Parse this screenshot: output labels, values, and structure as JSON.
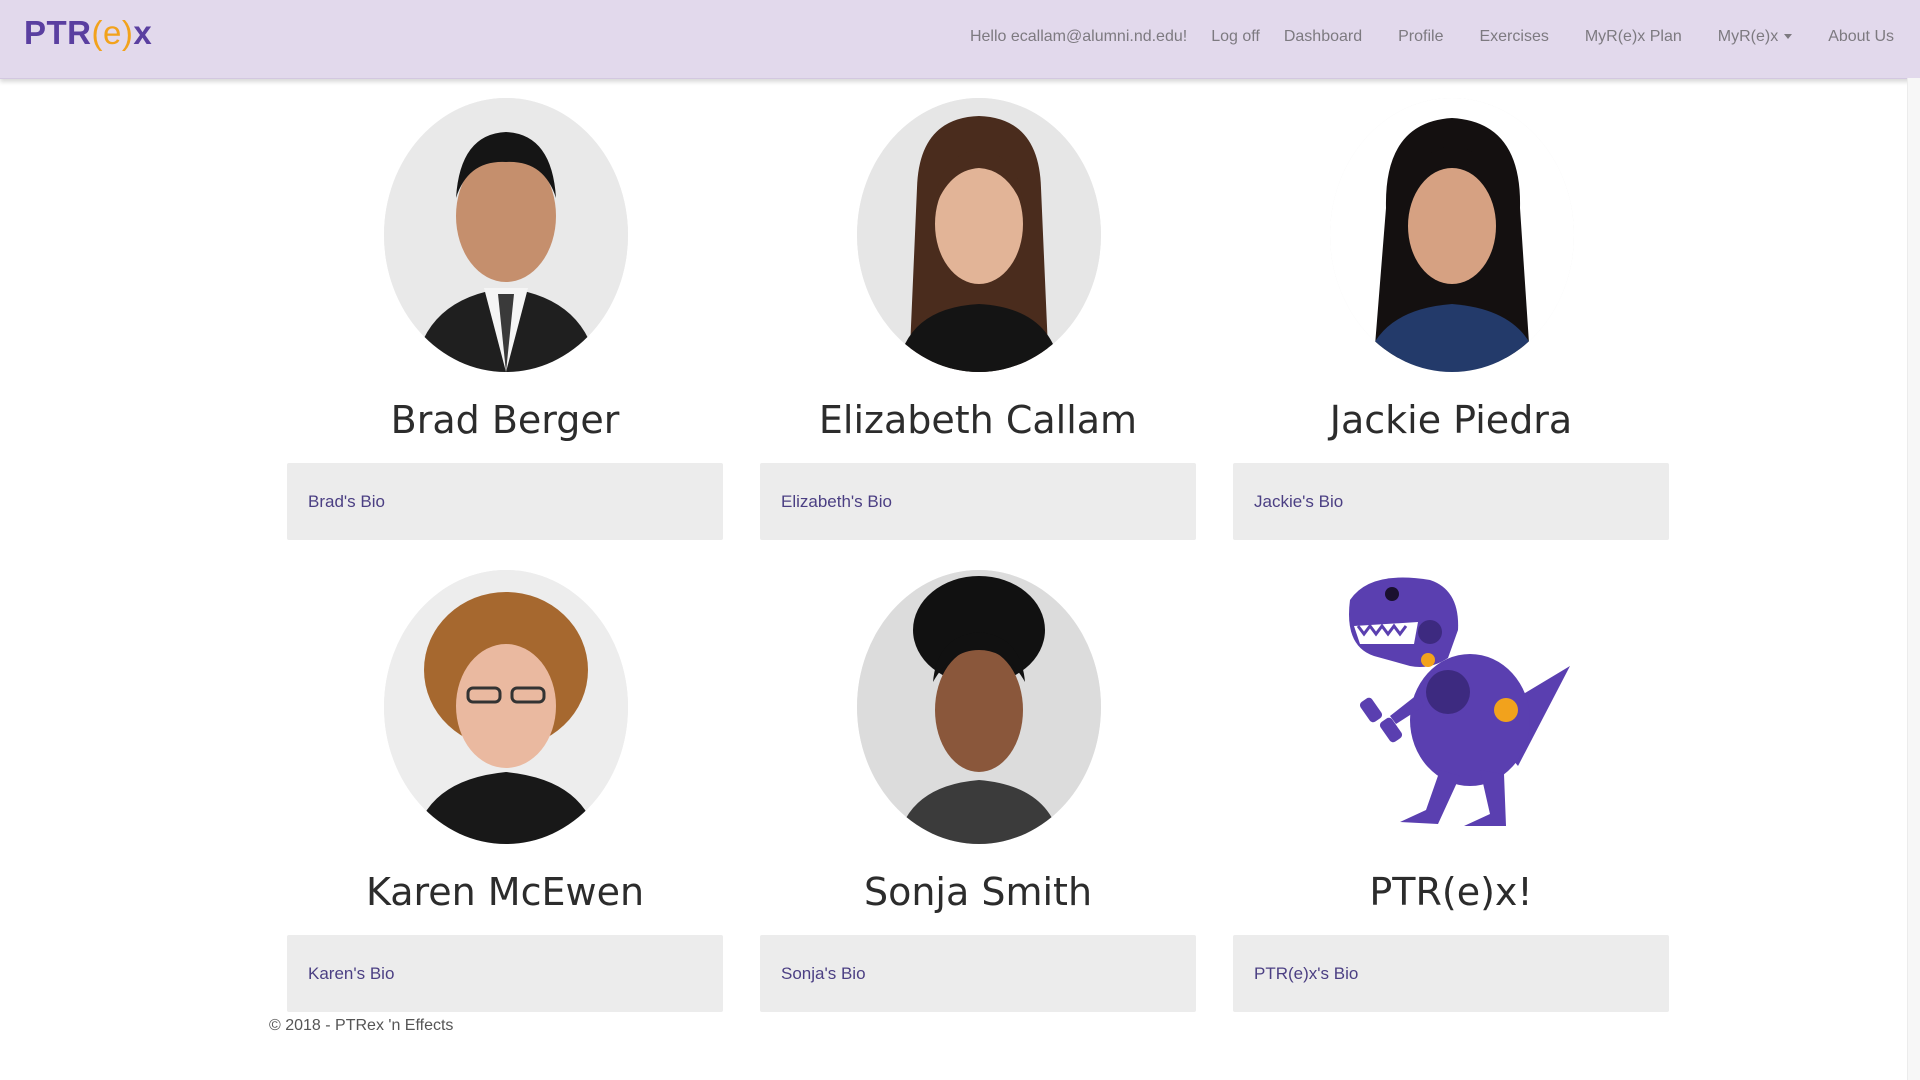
{
  "brand": {
    "prefix": "PTR",
    "middle": "(e)",
    "suffix": "x"
  },
  "nav": {
    "greeting": "Hello ecallam@alumni.nd.edu!",
    "logoff": "Log off",
    "dashboard": "Dashboard",
    "profile": "Profile",
    "exercises": "Exercises",
    "plan": "MyR(e)x Plan",
    "myrex": "MyR(e)x",
    "about": "About Us"
  },
  "team": [
    {
      "name": "Brad Berger",
      "bio": "Brad's Bio"
    },
    {
      "name": "Elizabeth Callam",
      "bio": "Elizabeth's Bio"
    },
    {
      "name": "Jackie Piedra",
      "bio": "Jackie's Bio"
    },
    {
      "name": "Karen McEwen",
      "bio": "Karen's Bio"
    },
    {
      "name": "Sonja Smith",
      "bio": "Sonja's Bio"
    },
    {
      "name": "PTR(e)x!",
      "bio": "PTR(e)x's Bio"
    }
  ],
  "footer": {
    "text": "© 2018 - PTRex 'n Effects"
  },
  "colors": {
    "navbar": "#e2d9ec",
    "brand": "#5a3fa0",
    "accent": "#f2a21c",
    "link": "#4b3f83"
  }
}
